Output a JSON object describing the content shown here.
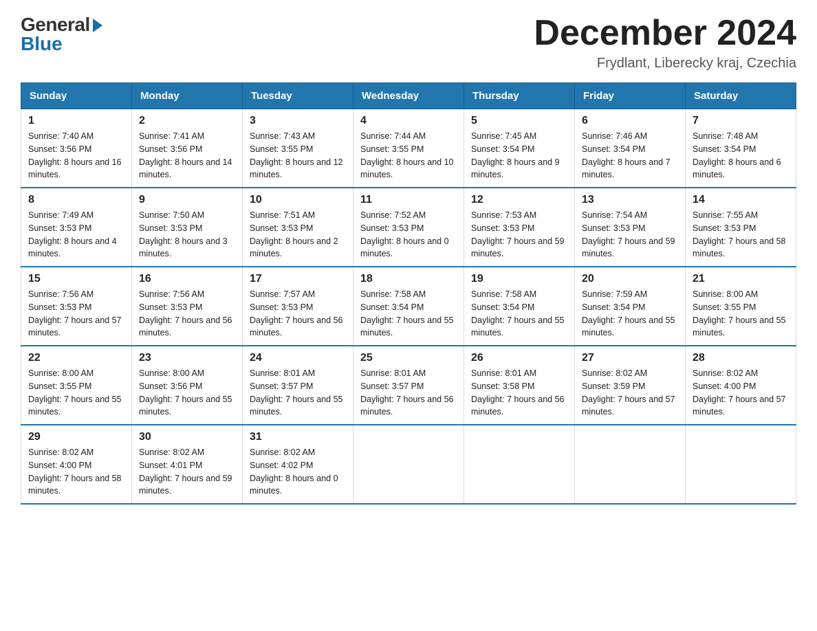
{
  "header": {
    "logo_general": "General",
    "logo_blue": "Blue",
    "month_title": "December 2024",
    "location": "Frydlant, Liberecky kraj, Czechia"
  },
  "weekdays": [
    "Sunday",
    "Monday",
    "Tuesday",
    "Wednesday",
    "Thursday",
    "Friday",
    "Saturday"
  ],
  "weeks": [
    [
      {
        "day": "1",
        "sunrise": "7:40 AM",
        "sunset": "3:56 PM",
        "daylight": "8 hours and 16 minutes."
      },
      {
        "day": "2",
        "sunrise": "7:41 AM",
        "sunset": "3:56 PM",
        "daylight": "8 hours and 14 minutes."
      },
      {
        "day": "3",
        "sunrise": "7:43 AM",
        "sunset": "3:55 PM",
        "daylight": "8 hours and 12 minutes."
      },
      {
        "day": "4",
        "sunrise": "7:44 AM",
        "sunset": "3:55 PM",
        "daylight": "8 hours and 10 minutes."
      },
      {
        "day": "5",
        "sunrise": "7:45 AM",
        "sunset": "3:54 PM",
        "daylight": "8 hours and 9 minutes."
      },
      {
        "day": "6",
        "sunrise": "7:46 AM",
        "sunset": "3:54 PM",
        "daylight": "8 hours and 7 minutes."
      },
      {
        "day": "7",
        "sunrise": "7:48 AM",
        "sunset": "3:54 PM",
        "daylight": "8 hours and 6 minutes."
      }
    ],
    [
      {
        "day": "8",
        "sunrise": "7:49 AM",
        "sunset": "3:53 PM",
        "daylight": "8 hours and 4 minutes."
      },
      {
        "day": "9",
        "sunrise": "7:50 AM",
        "sunset": "3:53 PM",
        "daylight": "8 hours and 3 minutes."
      },
      {
        "day": "10",
        "sunrise": "7:51 AM",
        "sunset": "3:53 PM",
        "daylight": "8 hours and 2 minutes."
      },
      {
        "day": "11",
        "sunrise": "7:52 AM",
        "sunset": "3:53 PM",
        "daylight": "8 hours and 0 minutes."
      },
      {
        "day": "12",
        "sunrise": "7:53 AM",
        "sunset": "3:53 PM",
        "daylight": "7 hours and 59 minutes."
      },
      {
        "day": "13",
        "sunrise": "7:54 AM",
        "sunset": "3:53 PM",
        "daylight": "7 hours and 59 minutes."
      },
      {
        "day": "14",
        "sunrise": "7:55 AM",
        "sunset": "3:53 PM",
        "daylight": "7 hours and 58 minutes."
      }
    ],
    [
      {
        "day": "15",
        "sunrise": "7:56 AM",
        "sunset": "3:53 PM",
        "daylight": "7 hours and 57 minutes."
      },
      {
        "day": "16",
        "sunrise": "7:56 AM",
        "sunset": "3:53 PM",
        "daylight": "7 hours and 56 minutes."
      },
      {
        "day": "17",
        "sunrise": "7:57 AM",
        "sunset": "3:53 PM",
        "daylight": "7 hours and 56 minutes."
      },
      {
        "day": "18",
        "sunrise": "7:58 AM",
        "sunset": "3:54 PM",
        "daylight": "7 hours and 55 minutes."
      },
      {
        "day": "19",
        "sunrise": "7:58 AM",
        "sunset": "3:54 PM",
        "daylight": "7 hours and 55 minutes."
      },
      {
        "day": "20",
        "sunrise": "7:59 AM",
        "sunset": "3:54 PM",
        "daylight": "7 hours and 55 minutes."
      },
      {
        "day": "21",
        "sunrise": "8:00 AM",
        "sunset": "3:55 PM",
        "daylight": "7 hours and 55 minutes."
      }
    ],
    [
      {
        "day": "22",
        "sunrise": "8:00 AM",
        "sunset": "3:55 PM",
        "daylight": "7 hours and 55 minutes."
      },
      {
        "day": "23",
        "sunrise": "8:00 AM",
        "sunset": "3:56 PM",
        "daylight": "7 hours and 55 minutes."
      },
      {
        "day": "24",
        "sunrise": "8:01 AM",
        "sunset": "3:57 PM",
        "daylight": "7 hours and 55 minutes."
      },
      {
        "day": "25",
        "sunrise": "8:01 AM",
        "sunset": "3:57 PM",
        "daylight": "7 hours and 56 minutes."
      },
      {
        "day": "26",
        "sunrise": "8:01 AM",
        "sunset": "3:58 PM",
        "daylight": "7 hours and 56 minutes."
      },
      {
        "day": "27",
        "sunrise": "8:02 AM",
        "sunset": "3:59 PM",
        "daylight": "7 hours and 57 minutes."
      },
      {
        "day": "28",
        "sunrise": "8:02 AM",
        "sunset": "4:00 PM",
        "daylight": "7 hours and 57 minutes."
      }
    ],
    [
      {
        "day": "29",
        "sunrise": "8:02 AM",
        "sunset": "4:00 PM",
        "daylight": "7 hours and 58 minutes."
      },
      {
        "day": "30",
        "sunrise": "8:02 AM",
        "sunset": "4:01 PM",
        "daylight": "7 hours and 59 minutes."
      },
      {
        "day": "31",
        "sunrise": "8:02 AM",
        "sunset": "4:02 PM",
        "daylight": "8 hours and 0 minutes."
      },
      null,
      null,
      null,
      null
    ]
  ]
}
